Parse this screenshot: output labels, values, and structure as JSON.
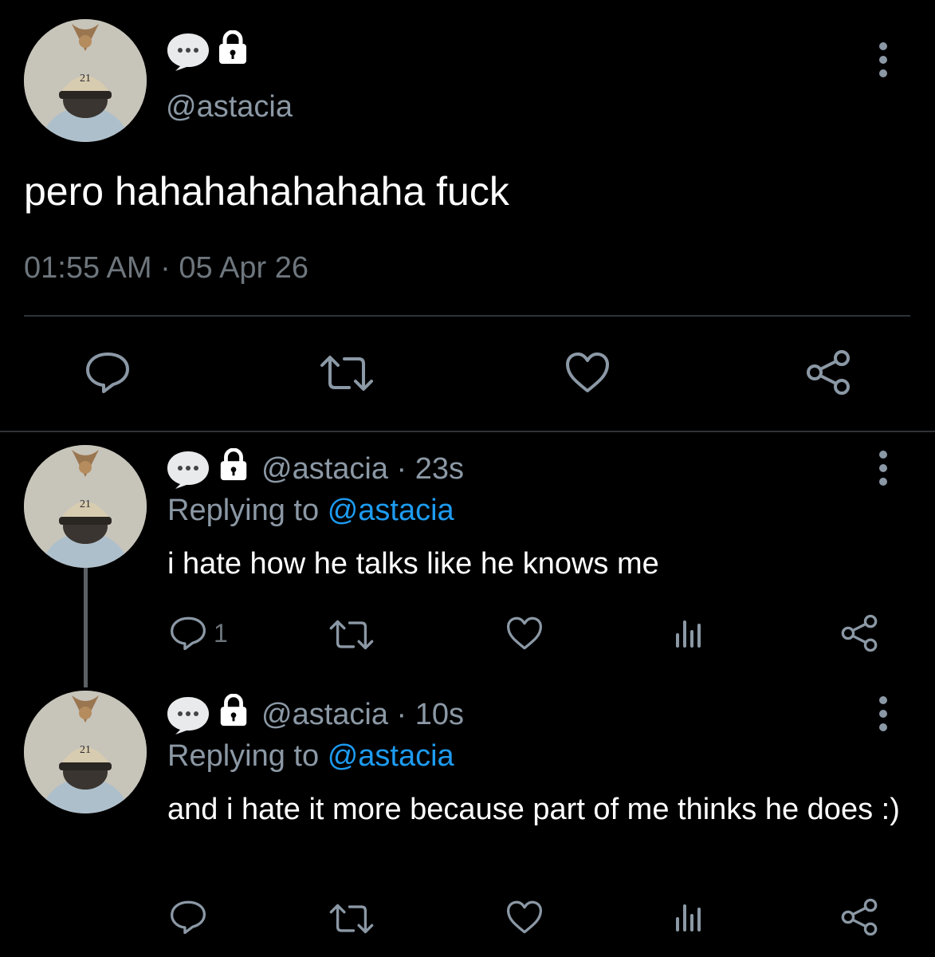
{
  "main_tweet": {
    "handle": "@astacia",
    "text": "pero hahahahahahaha fuck",
    "time": "01:55 AM",
    "separator": "·",
    "date": "05 Apr 26",
    "actions": [
      "reply-icon",
      "retweet-icon",
      "like-icon",
      "share-icon"
    ]
  },
  "replies": [
    {
      "handle": "@astacia",
      "separator": "·",
      "age": "23s",
      "replying_prefix": "Replying to",
      "replying_to": "@astacia",
      "text": "i hate how he talks like he knows me",
      "reply_count": "1",
      "actions": [
        "reply-icon",
        "retweet-icon",
        "like-icon",
        "analytics-icon",
        "share-icon"
      ]
    },
    {
      "handle": "@astacia",
      "separator": "·",
      "age": "10s",
      "replying_prefix": "Replying to",
      "replying_to": "@astacia",
      "text": "and i hate it more because part of me thinks he does :)",
      "reply_count": "",
      "actions": [
        "reply-icon",
        "retweet-icon",
        "like-icon",
        "analytics-icon",
        "share-icon"
      ]
    }
  ],
  "colors": {
    "background": "#000000",
    "primary_text": "#ffffff",
    "secondary_text": "#8b98a5",
    "muted_text": "#6e767d",
    "mention": "#1d9bf0",
    "divider": "#2f3336",
    "icon": "#8b98a5"
  }
}
